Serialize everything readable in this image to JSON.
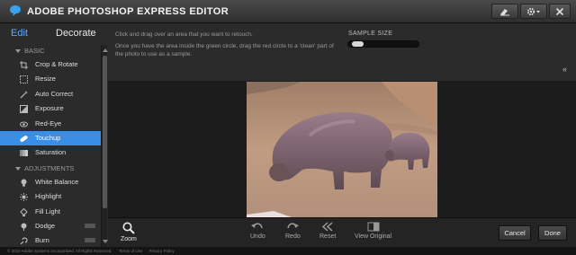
{
  "app": {
    "title": "ADOBE PHOTOSHOP EXPRESS EDITOR"
  },
  "tabs": {
    "edit": "Edit",
    "decorate": "Decorate"
  },
  "sidebar": {
    "sections": [
      {
        "label": "BASIC",
        "items": [
          {
            "label": "Crop & Rotate",
            "icon": "crop-icon"
          },
          {
            "label": "Resize",
            "icon": "resize-icon"
          },
          {
            "label": "Auto Correct",
            "icon": "wand-icon"
          },
          {
            "label": "Exposure",
            "icon": "exposure-icon"
          },
          {
            "label": "Red-Eye",
            "icon": "eye-icon"
          },
          {
            "label": "Touchup",
            "icon": "bandage-icon",
            "active": true
          },
          {
            "label": "Saturation",
            "icon": "saturation-icon"
          }
        ]
      },
      {
        "label": "ADJUSTMENTS",
        "items": [
          {
            "label": "White Balance",
            "icon": "lightbulb-icon"
          },
          {
            "label": "Highlight",
            "icon": "sun-icon"
          },
          {
            "label": "Fill Light",
            "icon": "fill-light-icon"
          },
          {
            "label": "Dodge",
            "icon": "dodge-icon"
          },
          {
            "label": "Burn",
            "icon": "burn-icon"
          }
        ]
      }
    ]
  },
  "infobar": {
    "instruction1": "Click and drag over an area that you want to retouch.",
    "instruction2": "Once you have the area inside the green circle, drag the red circle to a 'clean' part of the photo to use as a sample.",
    "sample_label": "SAMPLE SIZE",
    "sample_value": 0.05,
    "collapse_glyph": "«"
  },
  "toolbar": {
    "zoom": "Zoom",
    "undo": "Undo",
    "redo": "Redo",
    "reset": "Reset",
    "view_original": "View Original",
    "cancel": "Cancel",
    "done": "Done"
  },
  "footer": {
    "copyright": "© 2010 Adobe Systems Incorporated. All Rights Reserved.",
    "terms": "Terms of Use",
    "privacy": "Privacy Policy"
  },
  "colors": {
    "accent": "#3a8ee6",
    "edit_tab": "#5aa9ff"
  }
}
